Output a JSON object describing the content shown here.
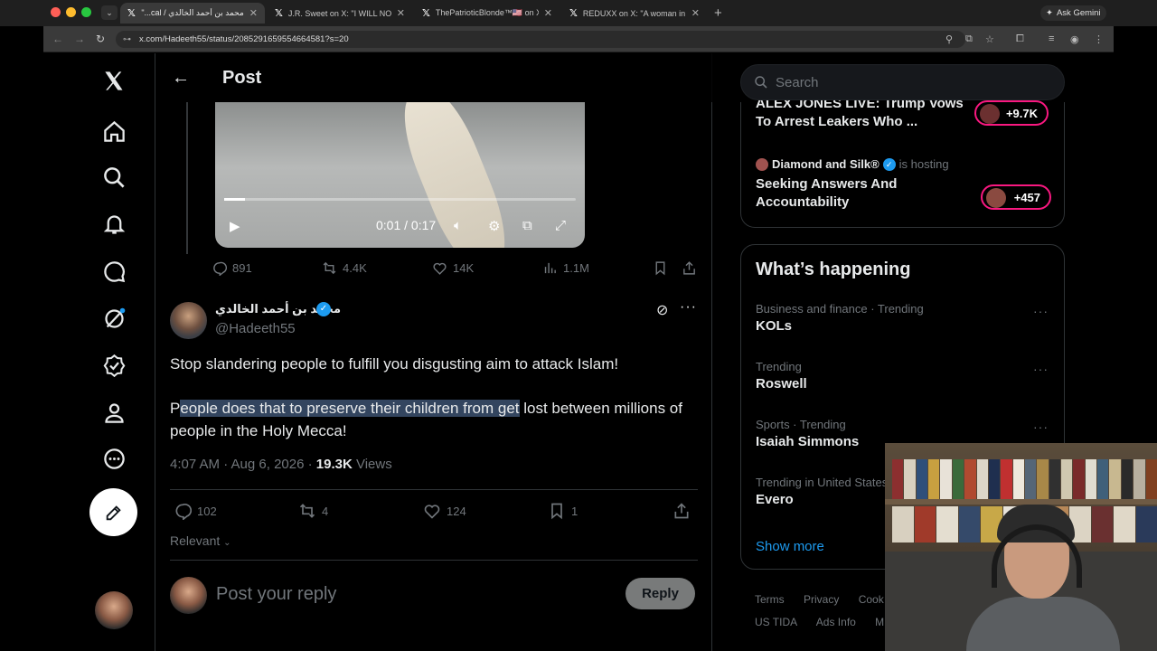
{
  "browser": {
    "tabs": [
      {
        "title": "محمد بن أحمد الخالدي / X \"...cal!\"",
        "active": true
      },
      {
        "title": "J.R. Sweet on X: \"I WILL NOT",
        "active": false
      },
      {
        "title": "ThePatrioticBlonde™🇺🇸 on X",
        "active": false
      },
      {
        "title": "REDUXX on X: \"A woman in B",
        "active": false
      }
    ],
    "url": "x.com/Hadeeth55/status/2085291659554664581?s=20",
    "ask_gemini": "Ask Gemini"
  },
  "header": {
    "title": "Post"
  },
  "video": {
    "time": "0:01 / 0:17",
    "progress": 0.06
  },
  "video_stats": {
    "replies": "891",
    "reposts": "4.4K",
    "likes": "14K",
    "views": "1.1M"
  },
  "tweet": {
    "author_name": "محمد بن أحمد الخالدي",
    "handle": "@Hadeeth55",
    "line1": "Stop slandering people to fulfill you disgusting aim to attack Islam!",
    "line2_first": "P",
    "line2_highlight": "eople does that to preserve their children from get",
    "line2_rest": " lost between millions of people in the Holy Mecca!",
    "time": "4:07 AM · Aug 6, 2026 · ",
    "views_count": "19.3K",
    "views_label": " Views",
    "stats": {
      "replies": "102",
      "reposts": "4",
      "likes": "124",
      "bookmarks": "1"
    }
  },
  "sort": {
    "label": "Relevant"
  },
  "reply": {
    "placeholder": "Post your reply",
    "button": "Reply"
  },
  "search": {
    "placeholder": "Search"
  },
  "spaces": [
    {
      "title": "ALEX JONES LIVE: Trump Vows To Arrest Leakers Who ...",
      "count": "+9.7K"
    },
    {
      "host": "Diamond and Silk®",
      "host_suffix": "is hosting",
      "title": "Seeking Answers And Accountability",
      "count": "+457"
    }
  ],
  "whats_happening": {
    "title": "What’s happening",
    "trends": [
      {
        "context": "Business and finance · Trending",
        "name": "KOLs"
      },
      {
        "context": "Trending",
        "name": "Roswell"
      },
      {
        "context": "Sports · Trending",
        "name": "Isaiah Simmons"
      },
      {
        "context": "Trending in United States",
        "name": "Evero"
      }
    ],
    "show_more": "Show more"
  },
  "footer": {
    "links": [
      "Terms",
      "Privacy",
      "Cook",
      "US TIDA",
      "Ads Info",
      "M"
    ]
  },
  "colors": {
    "accent": "#1d9bf0",
    "pill": "#f91880",
    "highlight": "#33455f"
  }
}
